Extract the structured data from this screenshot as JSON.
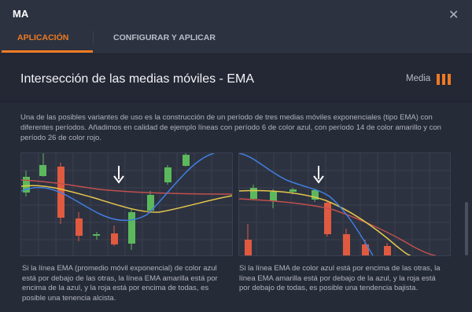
{
  "window": {
    "title": "MA"
  },
  "tabs": [
    {
      "label": "APLICACIÓN",
      "active": true
    },
    {
      "label": "CONFIGURAR Y APLICAR",
      "active": false
    }
  ],
  "header": {
    "title": "Intersección de las medias móviles - EMA",
    "level": "Media"
  },
  "description": "Una de las posibles variantes de uso es la construcción de un período de tres medias móviles exponenciales (tipo EMA) con diferentes períodos. Añadimos en calidad de ejemplo líneas con período 6 de color azul, con período 14 de color amarillo y con período 26 de color rojo.",
  "captions": [
    "Si la línea EMA (promedio móvil exponencial) de color azul está por debajo de las otras, la línea EMA amarilla está por encima de la azul, y la roja está por encima de todas, es posible una tenencia alcista.",
    "Si la línea EMA de color azul está por encima de las otras, la línea EMA amarilla está por debajo de la azul, y la roja está por debajo de todas, es posible una tendencia bajista."
  ],
  "colors": {
    "accent": "#ef7a22",
    "up": "#5cb85c",
    "down": "#e05a40",
    "ema_fast": "#3f7fe0",
    "ema_mid": "#e6c74a",
    "ema_slow": "#c0504d"
  }
}
